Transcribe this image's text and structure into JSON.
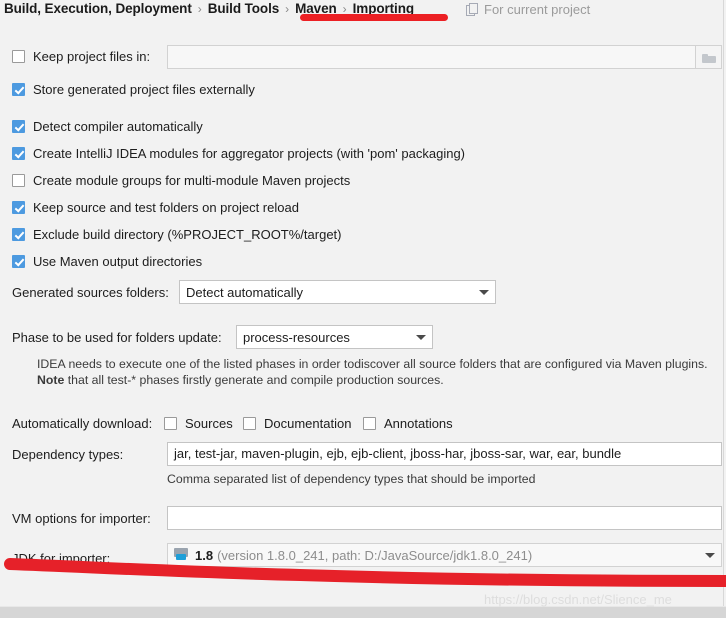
{
  "header": {
    "breadcrumb": [
      "Build, Execution, Deployment",
      "Build Tools",
      "Maven",
      "Importing"
    ],
    "separator": "›",
    "scope_label": "For current project",
    "scope_icon": "copy-icon"
  },
  "settings": {
    "keep_project_files": {
      "label": "Keep project files in:",
      "checked": false,
      "value": "",
      "browse_icon": "folder-icon"
    },
    "checkboxes": [
      {
        "label": "Store generated project files externally",
        "checked": true
      },
      {
        "label": "Detect compiler automatically",
        "checked": true
      },
      {
        "label": "Create IntelliJ IDEA modules for aggregator projects (with 'pom' packaging)",
        "checked": true
      },
      {
        "label": "Create module groups for multi-module Maven projects",
        "checked": false
      },
      {
        "label": "Keep source and test folders on project reload",
        "checked": true
      },
      {
        "label": "Exclude build directory (%PROJECT_ROOT%/target)",
        "checked": true
      },
      {
        "label": "Use Maven output directories",
        "checked": true
      }
    ],
    "generated_sources": {
      "label": "Generated sources folders:",
      "value": "Detect automatically"
    },
    "phase_update": {
      "label": "Phase to be used for folders update:",
      "value": "process-resources"
    },
    "phase_note_line1": "IDEA needs to execute one of the listed phases in order todiscover all source folders that are configured via Maven plugins.",
    "phase_note_line2_bold": "Note",
    "phase_note_line2_rest": " that all test-* phases firstly generate and compile production sources.",
    "auto_download": {
      "label": "Automatically download:",
      "options": [
        {
          "label": "Sources",
          "checked": false
        },
        {
          "label": "Documentation",
          "checked": false
        },
        {
          "label": "Annotations",
          "checked": false
        }
      ]
    },
    "dependency_types": {
      "label": "Dependency types:",
      "value": "jar, test-jar, maven-plugin, ejb, ejb-client, jboss-har, jboss-sar, war, ear, bundle",
      "hint": "Comma separated list of dependency types that should be imported"
    },
    "vm_options": {
      "label": "VM options for importer:",
      "value": ""
    },
    "jdk_importer": {
      "label": "JDK for importer:",
      "icon": "jdk-module-icon",
      "version": "1.8",
      "detail": "(version 1.8.0_241, path: D:/JavaSource/jdk1.8.0_241)"
    }
  },
  "annotations": {
    "color": "#ec2024",
    "top_underline_target": "Maven › Importing",
    "bottom_underline_target": "JDK for importer"
  },
  "watermark": "https://blog.csdn.net/Slience_me"
}
